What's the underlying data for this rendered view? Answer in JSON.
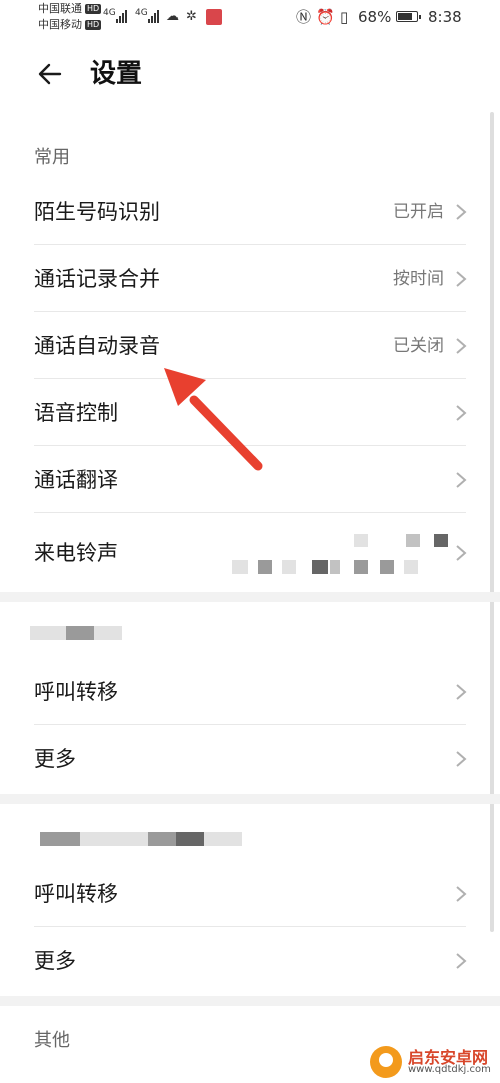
{
  "status_bar": {
    "carrier1": "中国联通",
    "carrier2": "中国移动",
    "hd": "HD",
    "net1": "4G",
    "net2": "4G",
    "battery_text": "68%",
    "battery_level": 0.68,
    "time": "8:38"
  },
  "header": {
    "title": "设置"
  },
  "section_common": {
    "label": "常用",
    "rows": [
      {
        "label": "陌生号码识别",
        "value": "已开启"
      },
      {
        "label": "通话记录合并",
        "value": "按时间"
      },
      {
        "label": "通话自动录音",
        "value": "已关闭"
      },
      {
        "label": "语音控制",
        "value": ""
      },
      {
        "label": "通话翻译",
        "value": ""
      },
      {
        "label": "来电铃声",
        "value": ""
      }
    ]
  },
  "section_sim1": {
    "rows": [
      {
        "label": "呼叫转移"
      },
      {
        "label": "更多"
      }
    ]
  },
  "section_sim2": {
    "rows": [
      {
        "label": "呼叫转移"
      },
      {
        "label": "更多"
      }
    ]
  },
  "section_other": {
    "label": "其他"
  },
  "watermark": {
    "title": "启东安卓网",
    "url": "www.qdtdkj.com"
  },
  "colors": {
    "annotation_arrow": "#e8402f",
    "watermark_orange": "#f39a1c"
  }
}
